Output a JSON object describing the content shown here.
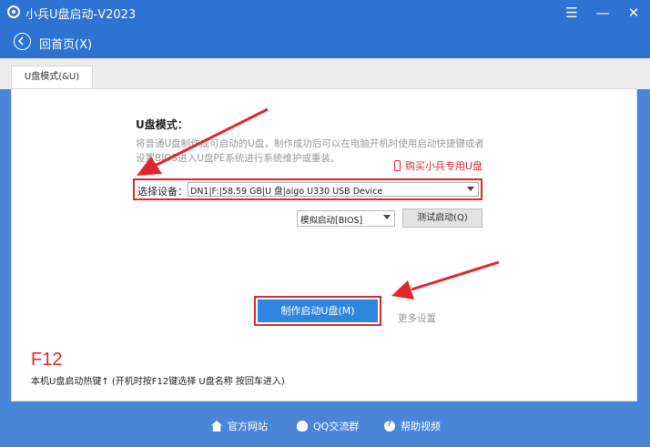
{
  "app": {
    "title": "小兵U盘启动-V2023",
    "menu_icon": "hamburger-icon",
    "minimize_icon": "minimize-icon",
    "close_icon": "close-icon"
  },
  "nav": {
    "back_icon": "back-arrow-icon",
    "back_label": "回首页(X)"
  },
  "tabs": [
    {
      "label": "U盘模式(&U)",
      "selected": true
    }
  ],
  "usb_mode": {
    "title": "U盘模式：",
    "description": "将普通U盘制作成可启动的U盘，制作成功后可以在电脑开机时使用启动快捷键或者设置BIOS进入U盘PE系统进行系统维护或重装。",
    "buy_link": "购买小兵专用U盘",
    "device_label": "选择设备：",
    "device_value": "DN1|F:|58.59 GB|U 盘|aigo U330 USB Device",
    "boot_mode_value": "模拟启动[BIOS]",
    "test_button": "测试启动(Q)",
    "make_button": "制作启动U盘(M)",
    "more_settings": "更多设置"
  },
  "hotkey": {
    "key": "F12",
    "text": "本机U盘启动热键↑ (开机时按F12键选择 U盘名称 按回车进入)"
  },
  "footer": {
    "links": [
      {
        "label": "官方网站",
        "icon": "home-icon"
      },
      {
        "label": "QQ交流群",
        "icon": "qq-icon"
      },
      {
        "label": "帮助视频",
        "icon": "help-icon"
      }
    ]
  },
  "colors": {
    "titlebar": "#2c73d2",
    "background": "#4a86d8",
    "accent_red": "#e0262d",
    "primary_button": "#2f86de"
  }
}
